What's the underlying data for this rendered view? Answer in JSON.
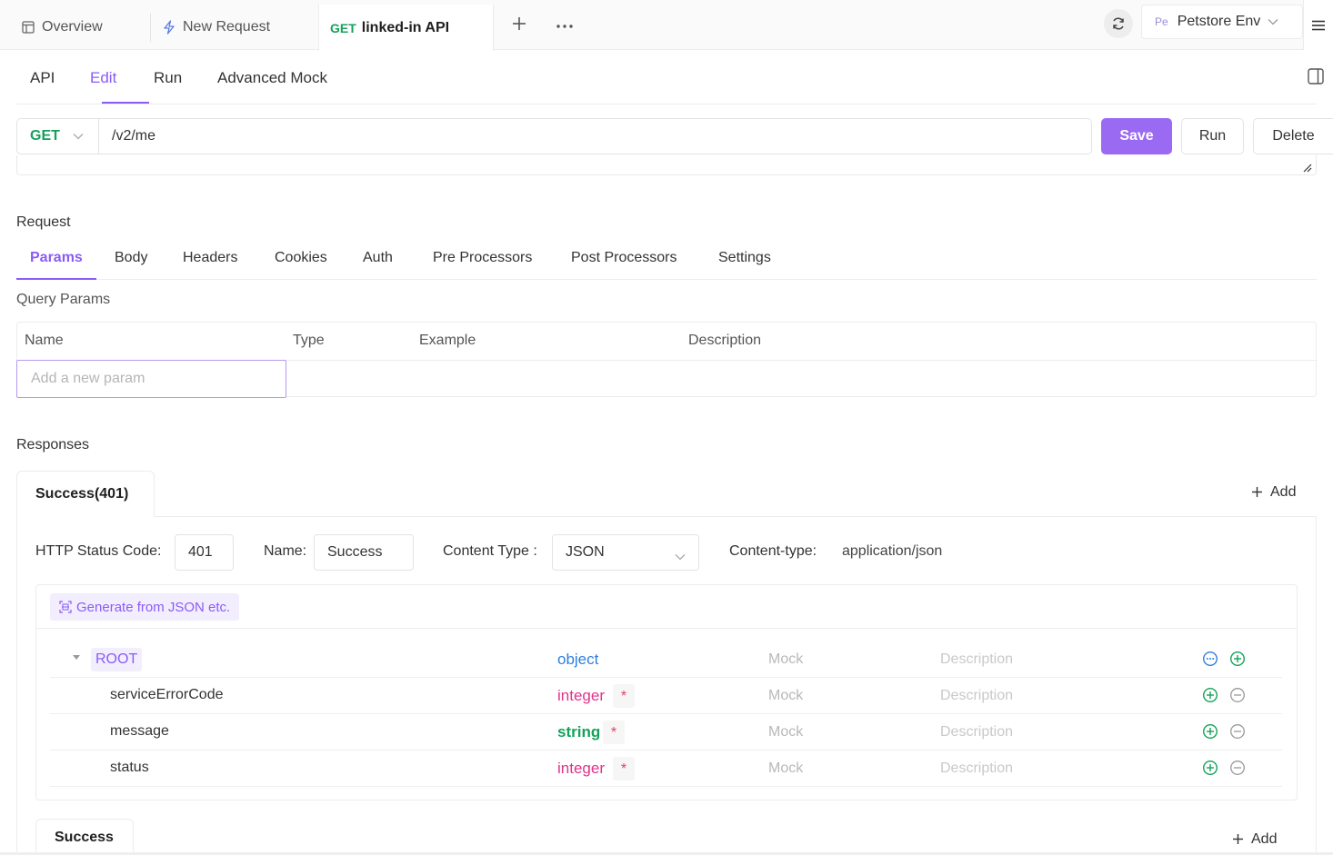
{
  "topbar": {
    "tabs": [
      {
        "label": "Overview",
        "icon": "layout-icon"
      },
      {
        "label": "New Request",
        "icon": "bolt-icon"
      }
    ],
    "active_tab": {
      "method": "GET",
      "title": "linked-in API"
    },
    "env": {
      "avatar": "Pe",
      "label": "Petstore Env"
    }
  },
  "subtabs": [
    "API",
    "Edit",
    "Run",
    "Advanced Mock"
  ],
  "active_subtab": "Edit",
  "url_bar": {
    "method": "GET",
    "path": "/v2/me",
    "save_label": "Save",
    "run_label": "Run",
    "delete_label": "Delete"
  },
  "request": {
    "title": "Request",
    "tabs": [
      "Params",
      "Body",
      "Headers",
      "Cookies",
      "Auth",
      "Pre Processors",
      "Post Processors",
      "Settings"
    ],
    "active_tab": "Params",
    "query_title": "Query Params",
    "columns": [
      "Name",
      "Type",
      "Example",
      "Description"
    ],
    "add_placeholder": "Add a new param"
  },
  "responses": {
    "title": "Responses",
    "active_tab": "Success(401)",
    "add_label": "Add",
    "status_label": "HTTP Status Code:",
    "status_value": "401",
    "name_label": "Name:",
    "name_value": "Success",
    "content_type_label": "Content Type :",
    "content_type_value": "JSON",
    "content_type_header_label": "Content-type:",
    "content_type_header_value": "application/json",
    "generate_label": "Generate from JSON etc.",
    "schema": [
      {
        "name": "ROOT",
        "type": "object",
        "mock": "Mock",
        "desc": "Description",
        "required": false
      },
      {
        "name": "serviceErrorCode",
        "type": "integer",
        "mock": "Mock",
        "desc": "Description",
        "required": true
      },
      {
        "name": "message",
        "type": "string",
        "mock": "Mock",
        "desc": "Description",
        "required": true
      },
      {
        "name": "status",
        "type": "integer",
        "mock": "Mock",
        "desc": "Description",
        "required": true
      }
    ],
    "required_mark": "*",
    "second_tab": "Success",
    "second_add_label": "Add"
  },
  "colors": {
    "accent": "#8a5cf5",
    "save_button": "#9b6af2",
    "get_method": "#14a15a",
    "type_object": "#2f7fe0",
    "type_integer": "#e0338a",
    "type_string": "#14a15a",
    "required": "#e83f5b"
  }
}
